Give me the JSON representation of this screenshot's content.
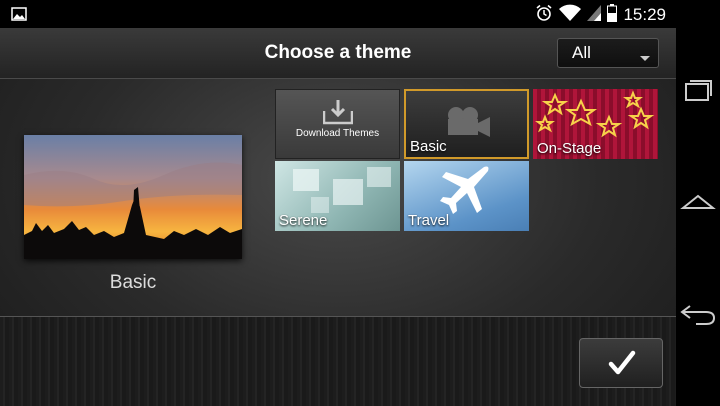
{
  "status_bar": {
    "time": "15:29",
    "icons": [
      "gallery-icon",
      "alarm-icon",
      "wifi-icon",
      "signal-icon",
      "battery-icon"
    ]
  },
  "header": {
    "title": "Choose a theme",
    "filter": {
      "selected": "All"
    }
  },
  "preview": {
    "label": "Basic"
  },
  "themes": [
    {
      "label": "Download Themes",
      "icon": "download-icon"
    },
    {
      "label": "Basic",
      "icon": "camera-icon",
      "selected": true
    },
    {
      "label": "On-Stage",
      "icon": "stars-icon"
    },
    {
      "label": "Serene"
    },
    {
      "label": "Travel",
      "icon": "airplane-icon"
    }
  ],
  "confirm": {
    "icon": "checkmark-icon"
  },
  "nav": {
    "icons": [
      "recent-apps-icon",
      "home-icon",
      "back-icon"
    ]
  },
  "colors": {
    "selected_border": "#d19a2a",
    "accent": "#ffffff"
  }
}
